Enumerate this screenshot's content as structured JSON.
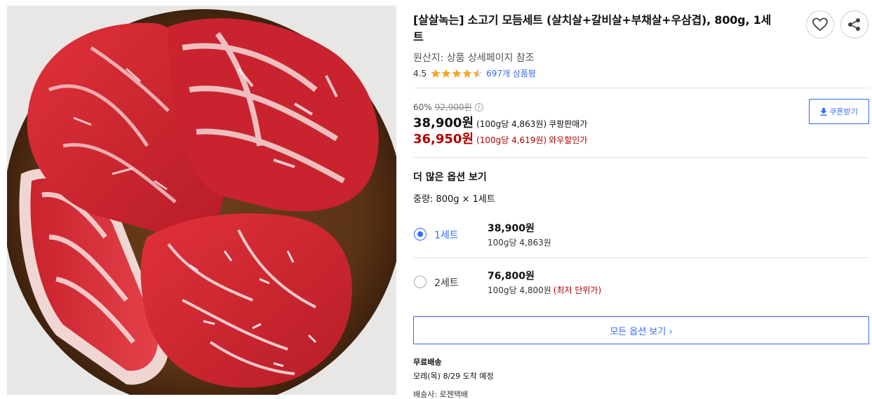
{
  "product": {
    "title": "[살살녹는] 소고기 모듬세트 (살치살+갈비살+부채살+우삼겹), 800g, 1세트",
    "origin": "원산지: 상품 상세페이지 참조",
    "rating_value": "4.5",
    "rating_stars": 4.5,
    "review_link": "697개 상품평"
  },
  "pricing": {
    "discount_rate": "60%",
    "original_price": "92,900원",
    "coupon_label": "쿠폰받기",
    "sale_price": "38,900원",
    "sale_unit": "(100g당 4,863원)",
    "sale_tag": "쿠팡판매가",
    "wow_price": "36,950원",
    "wow_unit": "(100g당 4,619원)",
    "wow_tag": "와우할인가"
  },
  "options": {
    "heading": "더 많은 옵션 보기",
    "weight_label": "중량: 800g × 1세트",
    "items": [
      {
        "label": "1세트",
        "price": "38,900원",
        "unit": "100g당 4,863원",
        "note": "",
        "selected": true
      },
      {
        "label": "2세트",
        "price": "76,800원",
        "unit": "100g당 4,800원",
        "note": "(최저 단위가)",
        "selected": false
      }
    ],
    "all_options_button": "모든 옵션 보기 ›"
  },
  "shipping": {
    "title": "무료배송",
    "arrival": "모레(목) 8/29 도착 예정",
    "carrier": "배송사: 로젠택배"
  },
  "colors": {
    "accent_blue": "#346aff",
    "wow_red": "#ae0000",
    "star_yellow": "#f5a623"
  },
  "icons": {
    "wishlist": "heart-icon",
    "share": "share-icon",
    "coupon": "download-icon",
    "price_info": "info-icon"
  }
}
